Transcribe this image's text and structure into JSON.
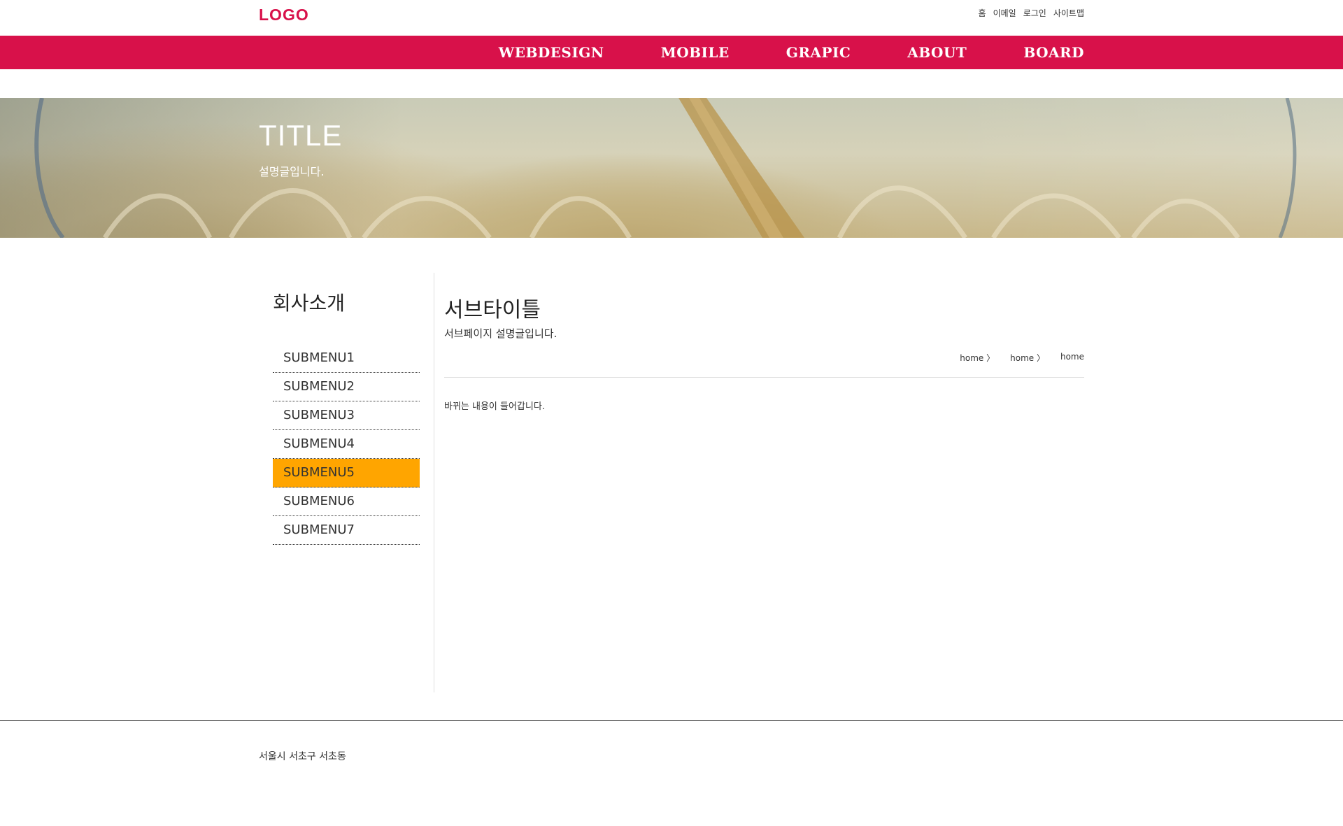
{
  "colors": {
    "brand": "#d8114a",
    "active": "#ffa500"
  },
  "header": {
    "logo": "LOGO",
    "util_links": [
      "홈",
      "이메일",
      "로그인",
      "사이트맵"
    ]
  },
  "gnb": [
    "WEBDESIGN",
    "MOBILE",
    "GRAPIC",
    "ABOUT",
    "BOARD"
  ],
  "visual": {
    "title": "TITLE",
    "desc": "설명글입니다."
  },
  "lnb": {
    "title": "회사소개",
    "items": [
      "SUBMENU1",
      "SUBMENU2",
      "SUBMENU3",
      "SUBMENU4",
      "SUBMENU5",
      "SUBMENU6",
      "SUBMENU7"
    ],
    "active_index": 4
  },
  "content": {
    "subtitle": "서브타이틀",
    "subdesc": "서브페이지 설명글입니다.",
    "breadcrumb": [
      "home 〉",
      "home 〉",
      "home"
    ],
    "body": "바뀌는 내용이 들어갑니다."
  },
  "footer": {
    "address": "서울시 서초구 서초동"
  }
}
